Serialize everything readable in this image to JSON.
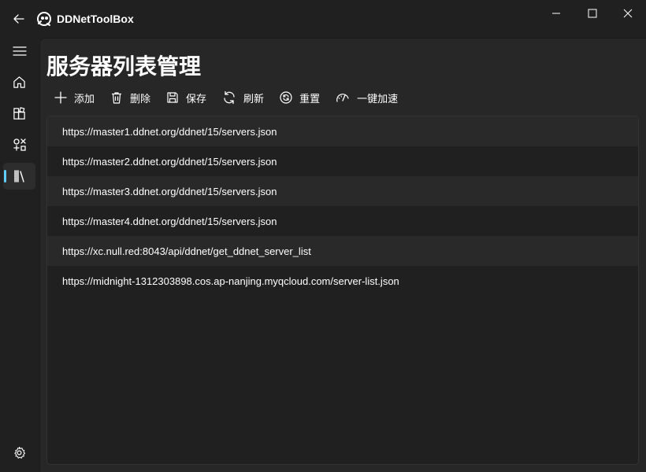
{
  "app": {
    "title": "DDNetToolBox"
  },
  "titlebar": {
    "back_icon": "arrow-left-icon",
    "minimize_icon": "minimize-icon",
    "maximize_icon": "maximize-icon",
    "close_icon": "close-icon"
  },
  "sidebar": {
    "items": [
      {
        "icon": "hamburger-menu-icon"
      },
      {
        "icon": "home-icon"
      },
      {
        "icon": "puzzle-apps-icon"
      },
      {
        "icon": "shapes-icon"
      },
      {
        "icon": "library-icon",
        "active": true
      }
    ],
    "settings_icon": "gear-icon",
    "accent": "#60cdff"
  },
  "page": {
    "title": "服务器列表管理"
  },
  "toolbar": {
    "add_label": "添加",
    "delete_label": "删除",
    "save_label": "保存",
    "refresh_label": "刷新",
    "reset_label": "重置",
    "accelerate_label": "一键加速"
  },
  "server_list": [
    "https://master1.ddnet.org/ddnet/15/servers.json",
    "https://master2.ddnet.org/ddnet/15/servers.json",
    "https://master3.ddnet.org/ddnet/15/servers.json",
    "https://master4.ddnet.org/ddnet/15/servers.json",
    "https://xc.null.red:8043/api/ddnet/get_ddnet_server_list",
    "https://midnight-1312303898.cos.ap-nanjing.myqcloud.com/server-list.json"
  ]
}
